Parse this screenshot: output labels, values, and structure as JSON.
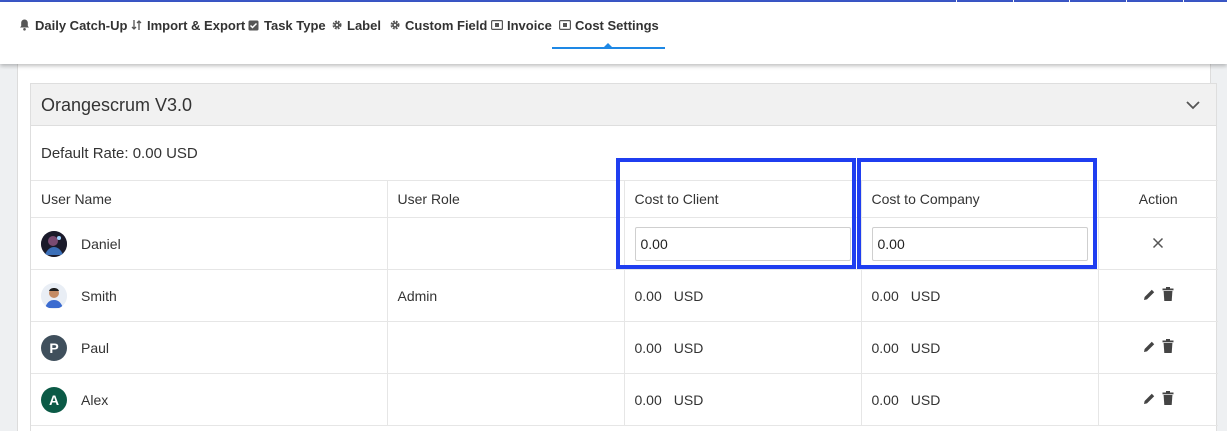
{
  "tabs": [
    {
      "label": "Daily Catch-Up",
      "icon": "bell-icon"
    },
    {
      "label": "Import & Export",
      "icon": "import-export-icon"
    },
    {
      "label": "Task Type",
      "icon": "checkbox-icon"
    },
    {
      "label": "Label",
      "icon": "gear-icon"
    },
    {
      "label": "Custom Field",
      "icon": "gear-icon"
    },
    {
      "label": "Invoice",
      "icon": "invoice-icon"
    },
    {
      "label": "Cost Settings",
      "icon": "cost-icon",
      "active": true
    }
  ],
  "project": {
    "title": "Orangescrum V3.0",
    "default_rate": "Default Rate: 0.00 USD"
  },
  "table": {
    "headers": {
      "user_name": "User Name",
      "user_role": "User Role",
      "cost_to_client": "Cost to Client",
      "cost_to_company": "Cost to Company",
      "action": "Action"
    },
    "edit_row": {
      "name": "Daniel",
      "role": "",
      "client_value": "0.00",
      "company_value": "0.00"
    },
    "rows": [
      {
        "name": "Smith",
        "role": "Admin",
        "client_amount": "0.00",
        "client_currency": "USD",
        "company_amount": "0.00",
        "company_currency": "USD"
      },
      {
        "name": "Paul",
        "initial": "P",
        "role": "",
        "client_amount": "0.00",
        "client_currency": "USD",
        "company_amount": "0.00",
        "company_currency": "USD"
      },
      {
        "name": "Alex",
        "initial": "A",
        "role": "",
        "client_amount": "0.00",
        "client_currency": "USD",
        "company_amount": "0.00",
        "company_currency": "USD"
      }
    ]
  },
  "colors": {
    "accent": "#1e88e5",
    "highlight": "#1f3ef0",
    "avatar_paul": "#3f4f5c",
    "avatar_alex": "#0b5a46"
  }
}
